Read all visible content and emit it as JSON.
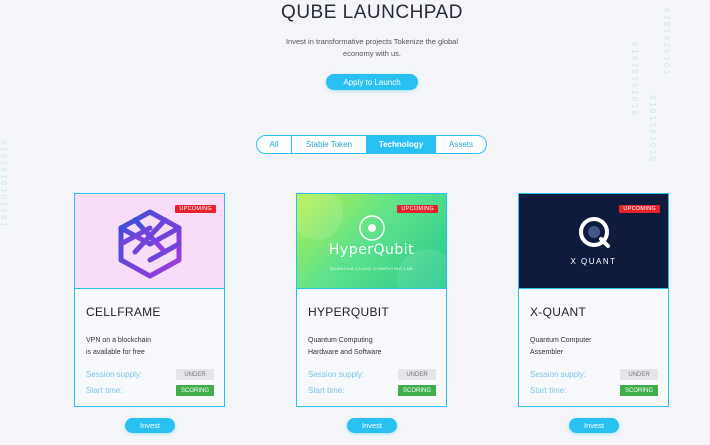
{
  "page": {
    "title": "QUBE LAUNCHPAD",
    "subtitle": "Invest in transformative projects Tokenize the global economy with us.",
    "apply_label": "Apply to Launch"
  },
  "tabs": [
    {
      "label": "All",
      "active": false
    },
    {
      "label": "Stable Token",
      "active": false
    },
    {
      "label": "Technology",
      "active": true
    },
    {
      "label": "Assets",
      "active": false
    }
  ],
  "projects": [
    {
      "name": "CELLFRAME",
      "status": "UPCOMING",
      "desc_line1": "VPN on a blockchain",
      "desc_line2": "is available for free",
      "supply_label": "Session supply:",
      "supply_value": "UNDER",
      "start_label": "Start time:",
      "start_value": "SCORING",
      "invest_label": "Invest",
      "banner_color": "#f8ddf8"
    },
    {
      "name": "HYPERQUBIT",
      "status": "UPCOMING",
      "desc_line1": "Quantum Computing",
      "desc_line2": "Hardware and Software",
      "supply_label": "Session supply:",
      "supply_value": "UNDER",
      "start_label": "Start time:",
      "start_value": "SCORING",
      "invest_label": "Invest",
      "logo_text": "HyperQubit",
      "logo_subtext": "QUANTUM CLOUD COMPUTING LAB",
      "banner_color": "#5fe38a"
    },
    {
      "name": "X-QUANT",
      "status": "UPCOMING",
      "desc_line1": "Quantum Computer",
      "desc_line2": "Assembler",
      "supply_label": "Session supply:",
      "supply_value": "UNDER",
      "start_label": "Start time:",
      "start_value": "SCORING",
      "invest_label": "Invest",
      "logo_text": "X QUANT",
      "banner_color": "#0f1b3d"
    }
  ],
  "decor": {
    "left_bits": "0101010101101",
    "right_bits_a": "01010101010",
    "right_bits_b": "0101101010",
    "right_bits_c": "0101010101"
  },
  "colors": {
    "accent": "#29c1f2",
    "badge": "#e4232d",
    "scoring": "#3eae4a",
    "under": "#e3e5e8"
  }
}
